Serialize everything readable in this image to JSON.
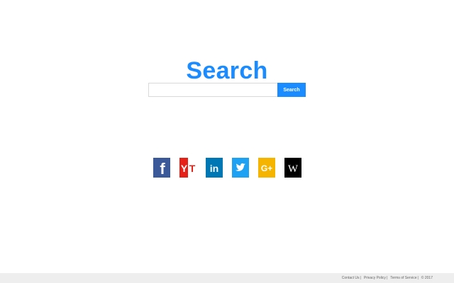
{
  "search": {
    "title": "Search",
    "input_value": "",
    "placeholder": "",
    "button_label": "Search"
  },
  "social": [
    {
      "name": "facebook",
      "glyph": "f",
      "color": "#3b5998"
    },
    {
      "name": "youtube",
      "glyph": "YT",
      "color": "#e62117"
    },
    {
      "name": "linkedin",
      "glyph": "in",
      "color": "#0077b5"
    },
    {
      "name": "twitter",
      "glyph": "twitter-bird",
      "color": "#1da1f2"
    },
    {
      "name": "google-plus",
      "glyph": "G+",
      "color": "#f4b400"
    },
    {
      "name": "wikipedia",
      "glyph": "W",
      "color": "#000000"
    }
  ],
  "footer": {
    "contact": "Contact Us",
    "privacy": "Privacy Policy",
    "terms": "Terms of Service",
    "copyright": "© 2017",
    "separator": "|"
  }
}
